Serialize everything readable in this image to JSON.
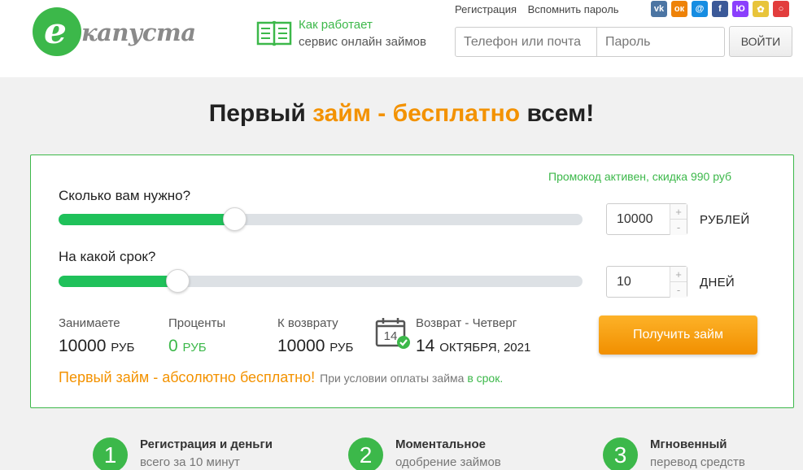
{
  "header": {
    "logo_letter": "e",
    "logo_text": "капуста",
    "how_line1": "Как работает",
    "how_line2": "сервис онлайн займов",
    "register_link": "Регистрация",
    "remind_link": "Вспомнить пароль",
    "socials": [
      {
        "name": "vk",
        "glyph": "vk",
        "color": "#4c75a3"
      },
      {
        "name": "ok",
        "glyph": "ок",
        "color": "#ee8208"
      },
      {
        "name": "mail",
        "glyph": "@",
        "color": "#168de2"
      },
      {
        "name": "facebook",
        "glyph": "f",
        "color": "#3b5998"
      },
      {
        "name": "yoomoney",
        "glyph": "Ю",
        "color": "#8b3ffd"
      },
      {
        "name": "sber",
        "glyph": "✿",
        "color": "#e8c43a"
      },
      {
        "name": "rambler",
        "glyph": "○",
        "color": "#e23d3d"
      }
    ],
    "phone_placeholder": "Телефон или почта",
    "password_placeholder": "Пароль",
    "login_button": "ВОЙТИ"
  },
  "headline": {
    "part1": "Первый ",
    "accent": "займ - бесплатно",
    "part2": " всем!"
  },
  "calculator": {
    "promo": "Промокод активен, скидка 990 руб",
    "amount_question": "Сколько вам нужно?",
    "amount_value": "10000",
    "amount_unit": "РУБЛЕЙ",
    "amount_fraction": 0.336,
    "term_question": "На какой срок?",
    "term_value": "10",
    "term_unit": "ДНЕЙ",
    "term_fraction": 0.226,
    "stepper_plus": "+",
    "stepper_minus": "-",
    "borrow_label": "Занимаете",
    "borrow_value": "10000",
    "borrow_currency": "РУБ",
    "interest_label": "Проценты",
    "interest_value": "0",
    "interest_currency": "РУБ",
    "return_label": "К возврату",
    "return_value": "10000",
    "return_currency": "РУБ",
    "calendar_day": "14",
    "return_day_label": "Возврат - Четверг",
    "return_date_day": "14",
    "return_date_rest": "ОКТЯБРЯ, 2021",
    "get_loan_button": "Получить займ",
    "free_text": "Первый займ - абсолютно бесплатно!",
    "condition_text": "При условии оплаты займа",
    "condition_accent": "в срок."
  },
  "steps": [
    {
      "num": "1",
      "title": "Регистрация и деньги",
      "subtitle": "всего за 10 минут"
    },
    {
      "num": "2",
      "title": "Моментальное",
      "subtitle": "одобрение займов"
    },
    {
      "num": "3",
      "title": "Мгновенный",
      "subtitle": "перевод средств"
    }
  ]
}
